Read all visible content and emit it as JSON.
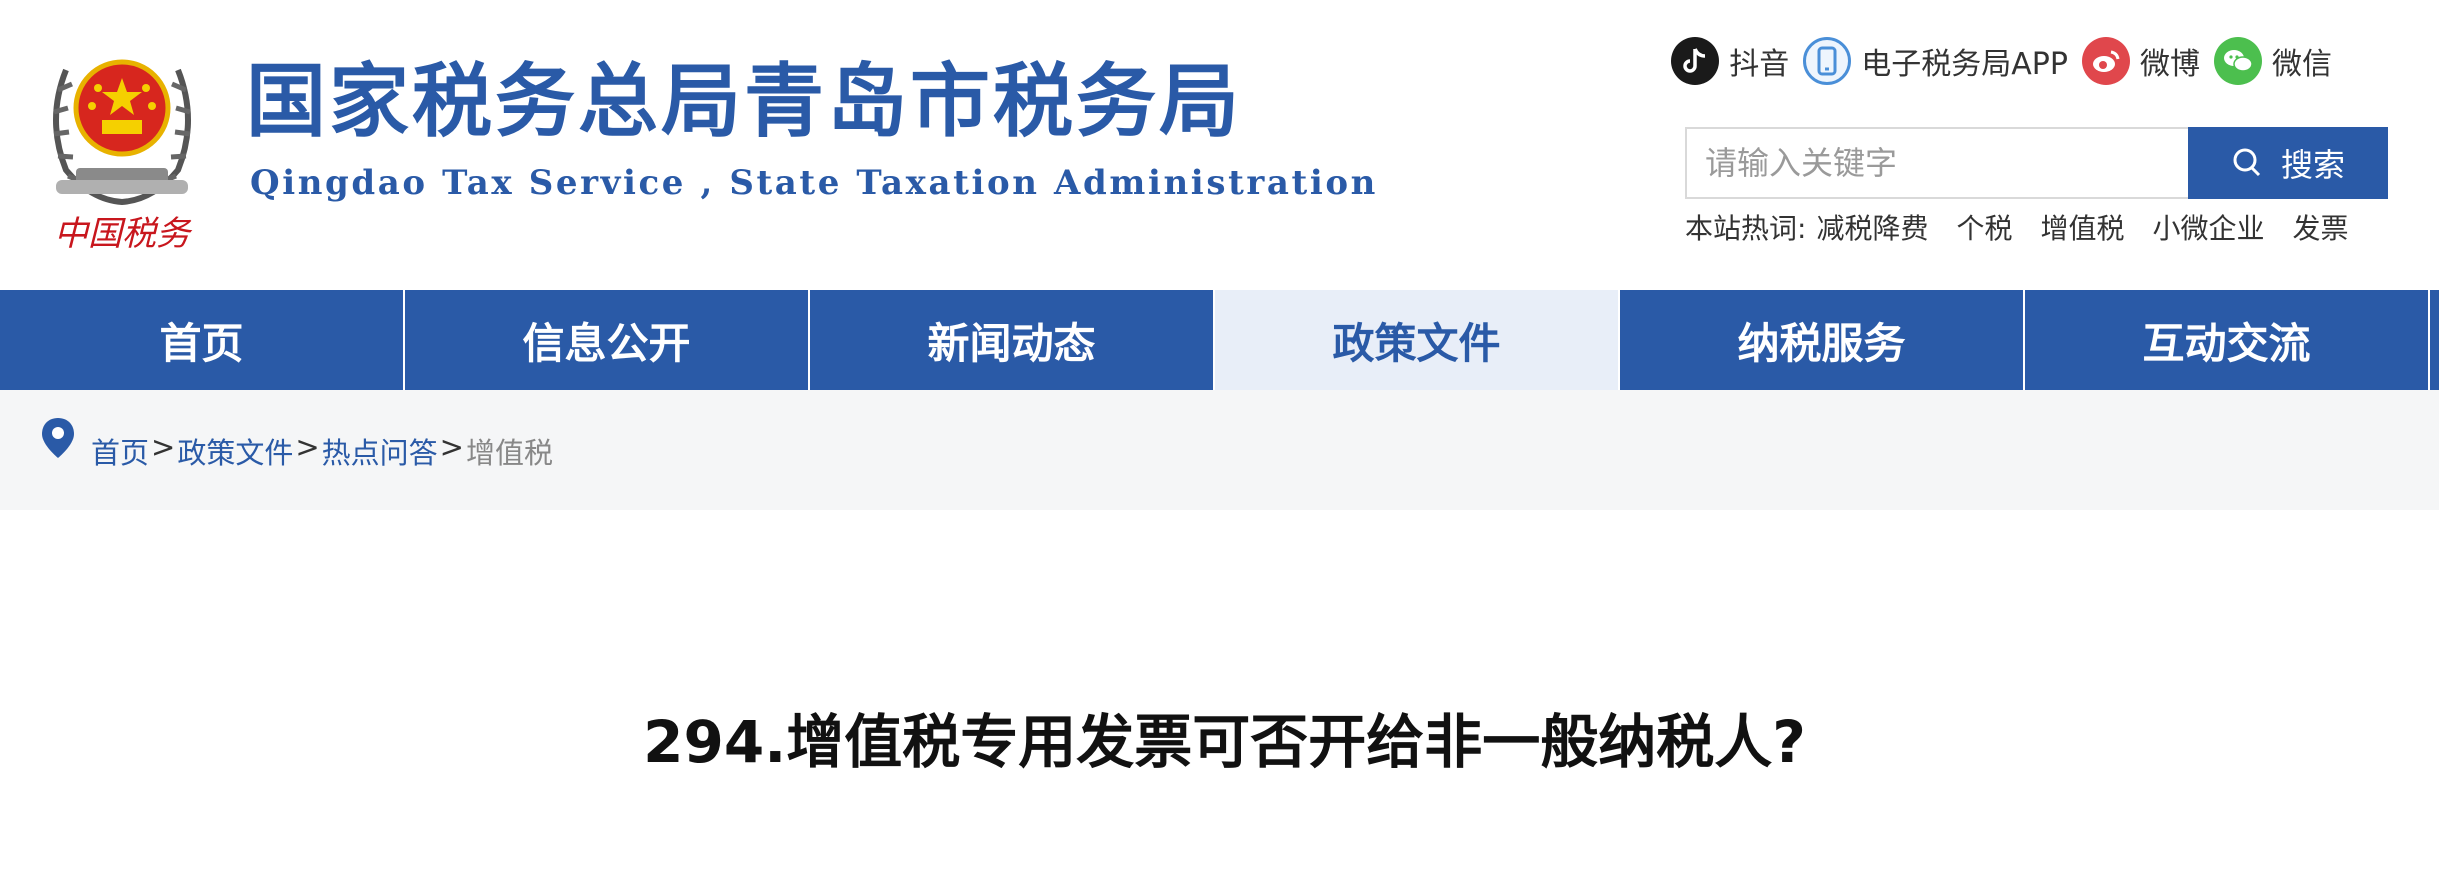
{
  "header": {
    "title_cn": "国家税务总局青岛市税务局",
    "title_en": "Qingdao Tax Service , State Taxation Administration",
    "emblem_caption": "中国税务",
    "emblem_icon": "national-emblem-icon"
  },
  "social": [
    {
      "label": "抖音",
      "icon": "douyin-icon",
      "color": "#1a1a1a"
    },
    {
      "label": "电子税务局APP",
      "icon": "phone-icon",
      "color": "#4a8fd8"
    },
    {
      "label": "微博",
      "icon": "weibo-icon",
      "color": "#e0474c"
    },
    {
      "label": "微信",
      "icon": "wechat-icon",
      "color": "#4cbf4e"
    }
  ],
  "search": {
    "placeholder": "请输入关键字",
    "button_label": "搜索",
    "hot_label": "本站热词:",
    "hot_words": [
      "减税降费",
      "个税",
      "增值税",
      "小微企业",
      "发票"
    ]
  },
  "nav": {
    "items": [
      {
        "label": "首页",
        "active": false
      },
      {
        "label": "信息公开",
        "active": false
      },
      {
        "label": "新闻动态",
        "active": false
      },
      {
        "label": "政策文件",
        "active": true
      },
      {
        "label": "纳税服务",
        "active": false
      },
      {
        "label": "互动交流",
        "active": false
      }
    ]
  },
  "breadcrumb": {
    "items": [
      "首页",
      "政策文件",
      "热点问答"
    ],
    "separator": ">",
    "current": "增值税"
  },
  "article": {
    "title": "294.增值税专用发票可否开给非一般纳税人?"
  },
  "colors": {
    "brand": "#2a5aa7",
    "nav_active_bg": "#e8eef8",
    "breadcrumb_bg": "#f5f6f7"
  }
}
